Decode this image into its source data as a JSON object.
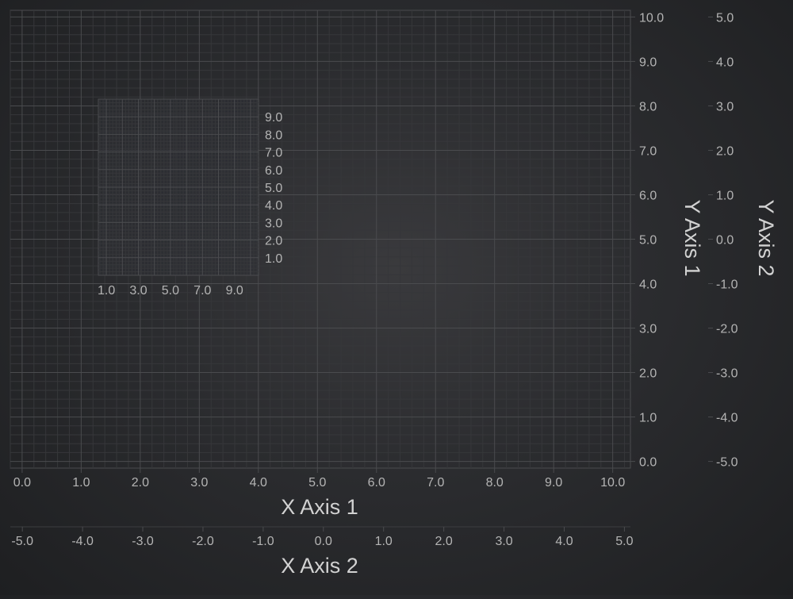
{
  "colors": {
    "background": "#2b2c2f",
    "major_grid": "#4a4b4e",
    "minor_grid": "#36373a",
    "tick_label": "#b4b4b4",
    "axis_title": "#d2d2d2"
  },
  "chart_data": {
    "type": "scatter",
    "series": [],
    "main_chart": {
      "grid": true,
      "x_axes": [
        {
          "title": "X Axis 1",
          "range": [
            -0.2,
            10.3
          ],
          "ticks": [
            0,
            1,
            2,
            3,
            4,
            5,
            6,
            7,
            8,
            9,
            10
          ],
          "tick_labels": [
            "0.0",
            "1.0",
            "2.0",
            "3.0",
            "4.0",
            "5.0",
            "6.0",
            "7.0",
            "8.0",
            "9.0",
            "10.0"
          ]
        },
        {
          "title": "X Axis 2",
          "range": [
            -5.2,
            5.1
          ],
          "ticks": [
            -5,
            -4,
            -3,
            -2,
            -1,
            0,
            1,
            2,
            3,
            4,
            5
          ],
          "tick_labels": [
            "-5.0",
            "-4.0",
            "-3.0",
            "-2.0",
            "-1.0",
            "0.0",
            "1.0",
            "2.0",
            "3.0",
            "4.0",
            "5.0"
          ]
        }
      ],
      "y_axes": [
        {
          "title": "Y Axis 1",
          "range": [
            -0.15,
            10.15
          ],
          "ticks": [
            0,
            1,
            2,
            3,
            4,
            5,
            6,
            7,
            8,
            9,
            10
          ],
          "tick_labels": [
            "0.0",
            "1.0",
            "2.0",
            "3.0",
            "4.0",
            "5.0",
            "6.0",
            "7.0",
            "8.0",
            "9.0",
            "10.0"
          ]
        },
        {
          "title": "Y Axis 2",
          "range": [
            -5.15,
            5.15
          ],
          "ticks": [
            -5,
            -4,
            -3,
            -2,
            -1,
            0,
            1,
            2,
            3,
            4,
            5
          ],
          "tick_labels": [
            "-5.0",
            "-4.0",
            "-3.0",
            "-2.0",
            "-1.0",
            "0.0",
            "1.0",
            "2.0",
            "3.0",
            "4.0",
            "5.0"
          ]
        }
      ]
    },
    "inset_chart": {
      "grid": true,
      "x_range": [
        0.5,
        10.5
      ],
      "y_range": [
        0,
        10
      ],
      "x_ticks": [
        1,
        3,
        5,
        7,
        9
      ],
      "x_tick_labels": [
        "1.0",
        "3.0",
        "5.0",
        "7.0",
        "9.0"
      ],
      "y_ticks": [
        1,
        2,
        3,
        4,
        5,
        6,
        7,
        8,
        9
      ],
      "y_tick_labels": [
        "1.0",
        "2.0",
        "3.0",
        "4.0",
        "5.0",
        "6.0",
        "7.0",
        "8.0",
        "9.0"
      ]
    }
  }
}
